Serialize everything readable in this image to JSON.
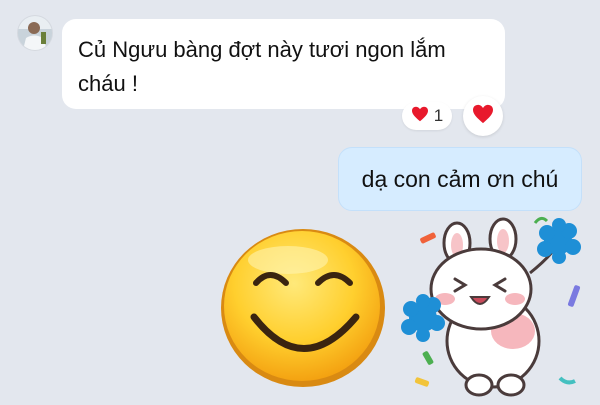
{
  "conversation": {
    "incoming": {
      "text": "Củ Ngưu bàng đợt này tươi ngon lắm cháu !",
      "reaction": {
        "icon": "heart-icon",
        "count": "1"
      }
    },
    "outgoing": {
      "text": "dạ con cảm ơn chú"
    },
    "stickers": [
      {
        "icon": "smiling-face-emoji"
      },
      {
        "icon": "cheering-bunny-sticker"
      }
    ]
  },
  "colors": {
    "background": "#e3e7ee",
    "incoming_bubble": "#ffffff",
    "outgoing_bubble": "#d6ecff",
    "heart": "#e8192c"
  }
}
